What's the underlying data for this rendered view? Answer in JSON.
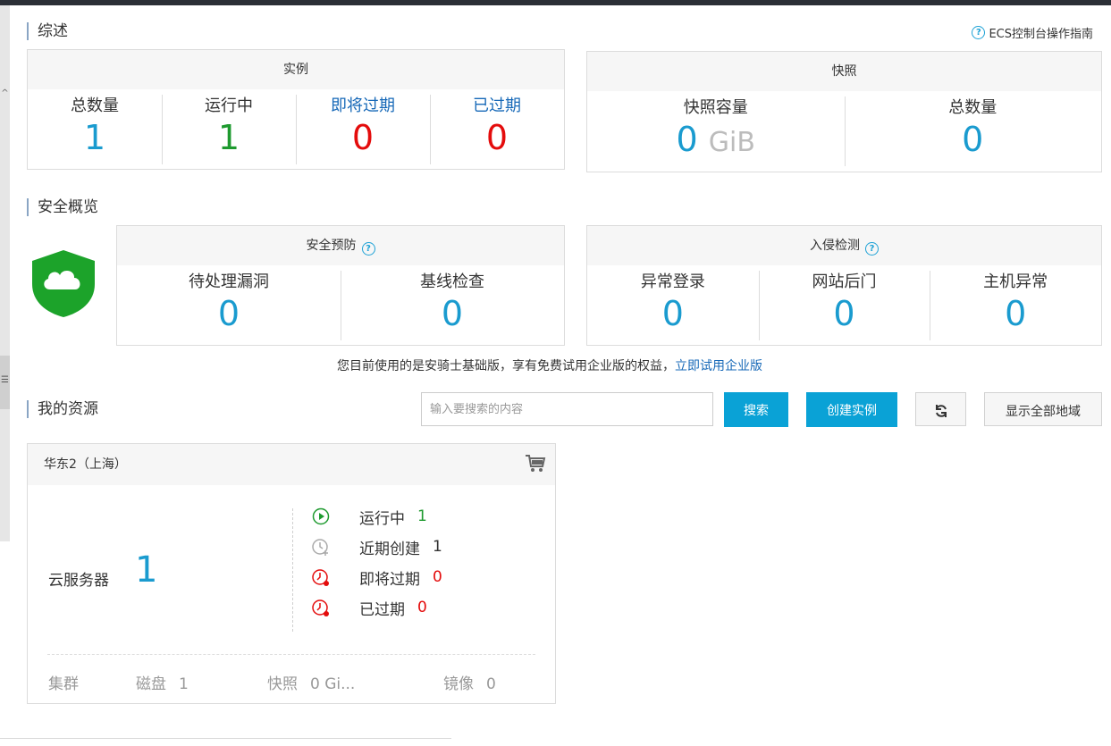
{
  "overview": {
    "title": "综述",
    "guide_link": "ECS控制台操作指南",
    "instances": {
      "title": "实例",
      "stats": [
        {
          "label": "总数量",
          "value": "1"
        },
        {
          "label": "运行中",
          "value": "1"
        },
        {
          "label": "即将过期",
          "value": "0"
        },
        {
          "label": "已过期",
          "value": "0"
        }
      ]
    },
    "snapshots": {
      "title": "快照",
      "capacity_label": "快照容量",
      "capacity_value": "0",
      "capacity_unit": "GiB",
      "total_label": "总数量",
      "total_value": "0"
    }
  },
  "security": {
    "title": "安全概览",
    "prevention": {
      "title": "安全预防",
      "stats": [
        {
          "label": "待处理漏洞",
          "value": "0"
        },
        {
          "label": "基线检查",
          "value": "0"
        }
      ]
    },
    "intrusion": {
      "title": "入侵检测",
      "stats": [
        {
          "label": "异常登录",
          "value": "0"
        },
        {
          "label": "网站后门",
          "value": "0"
        },
        {
          "label": "主机异常",
          "value": "0"
        }
      ]
    },
    "notice_text": "您目前使用的是安骑士基础版，享有免费试用企业版的权益，",
    "notice_link": "立即试用企业版"
  },
  "resources": {
    "title": "我的资源",
    "search_placeholder": "输入要搜索的内容",
    "search_button": "搜索",
    "create_button": "创建实例",
    "refresh_icon": "refresh-icon",
    "show_all_regions_button": "显示全部地域",
    "region": {
      "name": "华东2（上海）",
      "cart_icon": "cart-icon",
      "server_label": "云服务器",
      "server_count": "1",
      "statuses": [
        {
          "icon": "play-circle-icon",
          "label": "运行中",
          "value": "1"
        },
        {
          "icon": "clock-plus-icon",
          "label": "近期创建",
          "value": "1"
        },
        {
          "icon": "clock-alert-icon",
          "label": "即将过期",
          "value": "0"
        },
        {
          "icon": "clock-alert-icon",
          "label": "已过期",
          "value": "0"
        }
      ],
      "footer": [
        {
          "label": "集群",
          "value": ""
        },
        {
          "label": "磁盘",
          "value": "1"
        },
        {
          "label": "快照",
          "value": "0 Gi..."
        },
        {
          "label": "镜像",
          "value": "0"
        }
      ]
    }
  },
  "colors": {
    "accent_blue": "#1a9bcf",
    "button_blue": "#0aa2d6",
    "green": "#1e9a2f",
    "red": "#e40c0c",
    "link_blue": "#1769b8"
  }
}
